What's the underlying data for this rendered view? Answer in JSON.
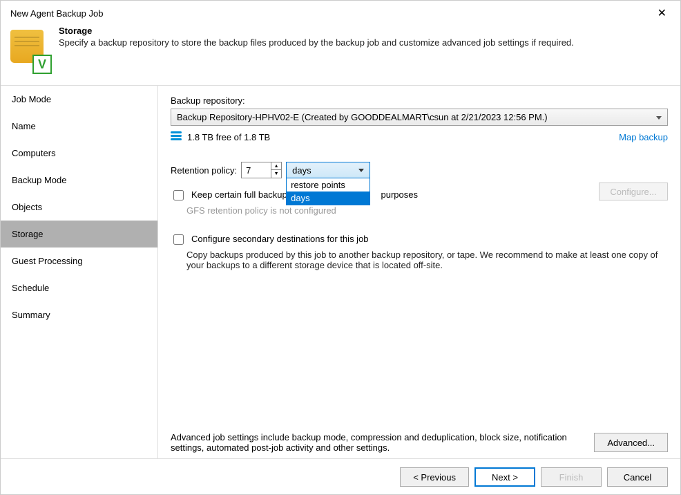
{
  "window": {
    "title": "New Agent Backup Job"
  },
  "header": {
    "title": "Storage",
    "subtitle": "Specify a backup repository to store the backup files produced by the backup job and customize advanced job settings if required."
  },
  "sidebar": {
    "items": [
      {
        "label": "Job Mode"
      },
      {
        "label": "Name"
      },
      {
        "label": "Computers"
      },
      {
        "label": "Backup Mode"
      },
      {
        "label": "Objects"
      },
      {
        "label": "Storage"
      },
      {
        "label": "Guest Processing"
      },
      {
        "label": "Schedule"
      },
      {
        "label": "Summary"
      }
    ]
  },
  "content": {
    "repo_label": "Backup repository:",
    "repo_value": "Backup Repository-HPHV02-E (Created by GOODDEALMART\\csun at 2/21/2023 12:56 PM.)",
    "free_text": "1.8 TB free of 1.8 TB",
    "map_link": "Map backup",
    "retention_label": "Retention policy:",
    "retention_value": "7",
    "unit_selected": "days",
    "unit_options": [
      "restore points",
      "days"
    ],
    "keep_label_before": "Keep certain full backups",
    "keep_label_after": "purposes",
    "keep_sub": "GFS retention policy is not configured",
    "configure_btn": "Configure...",
    "secondary_label": "Configure secondary destinations for this job",
    "secondary_sub": "Copy backups produced by this job to another backup repository, or tape. We recommend to make at least one copy of your backups to a different storage device that is located off-site.",
    "advanced_text": "Advanced job settings include backup mode, compression and deduplication, block size, notification settings, automated post-job activity and other settings.",
    "advanced_btn": "Advanced..."
  },
  "footer": {
    "previous": "< Previous",
    "next": "Next >",
    "finish": "Finish",
    "cancel": "Cancel"
  }
}
